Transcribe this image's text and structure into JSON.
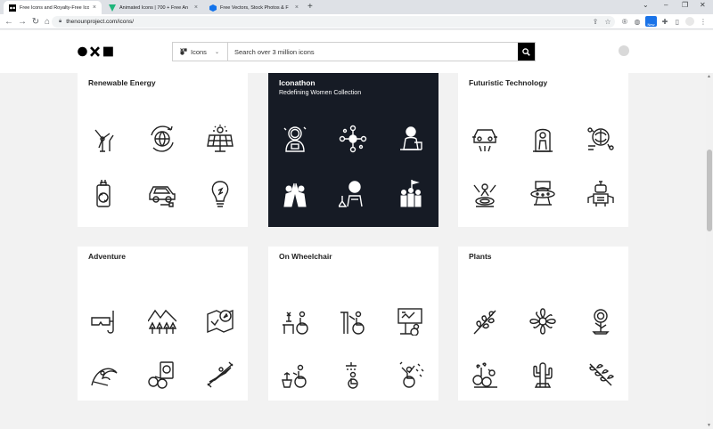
{
  "browser": {
    "tabs": [
      {
        "title": "Free Icons and Royalty-Free Ico",
        "active": true
      },
      {
        "title": "Animated Icons | 700 + Free An",
        "active": false
      },
      {
        "title": "Free Vectors, Stock Photos & F",
        "active": false
      }
    ],
    "url": "thenounproject.com/icons/",
    "new_badge": "New"
  },
  "header": {
    "search_type": "Icons",
    "search_placeholder": "Search over 3 million icons"
  },
  "collections": [
    {
      "title": "Renewable Energy",
      "subtitle": "",
      "theme": "light",
      "icons": [
        "wind-turbine-icon",
        "globe-cycle-icon",
        "solar-panel-icon",
        "battery-recycle-icon",
        "electric-car-icon",
        "idea-bulb-icon"
      ]
    },
    {
      "title": "Iconathon",
      "subtitle": "Redefining Women Collection",
      "theme": "dark",
      "icons": [
        "astronaut-woman-icon",
        "network-people-icon",
        "scientist-woman-icon",
        "high-five-icon",
        "lab-researcher-icon",
        "crowd-flag-icon"
      ]
    },
    {
      "title": "Futuristic Technology",
      "subtitle": "",
      "theme": "light",
      "icons": [
        "flying-car-icon",
        "cryo-pod-icon",
        "brain-chip-icon",
        "hologram-icon",
        "ufo-icon",
        "robot-icon"
      ]
    },
    {
      "title": "Adventure",
      "subtitle": "",
      "theme": "light",
      "icons": [
        "snorkel-mask-icon",
        "mountains-forest-icon",
        "map-compass-icon",
        "surf-wave-icon",
        "passport-binoculars-icon",
        "kayak-icon"
      ]
    },
    {
      "title": "On Wheelchair",
      "subtitle": "",
      "theme": "light",
      "icons": [
        "wheelchair-cooking-icon",
        "wheelchair-painting-icon",
        "wheelchair-presenting-icon",
        "wheelchair-gardening-icon",
        "wheelchair-shower-icon",
        "wheelchair-celebrate-icon"
      ]
    },
    {
      "title": "Plants",
      "subtitle": "",
      "theme": "light",
      "icons": [
        "leafy-branch-icon",
        "flower-icon",
        "sunflower-icon",
        "herb-icon",
        "cactus-icon",
        "olive-branch-icon"
      ]
    }
  ],
  "colors": {
    "dark_card": "#161b25",
    "page_bg": "#f2f2f2"
  }
}
